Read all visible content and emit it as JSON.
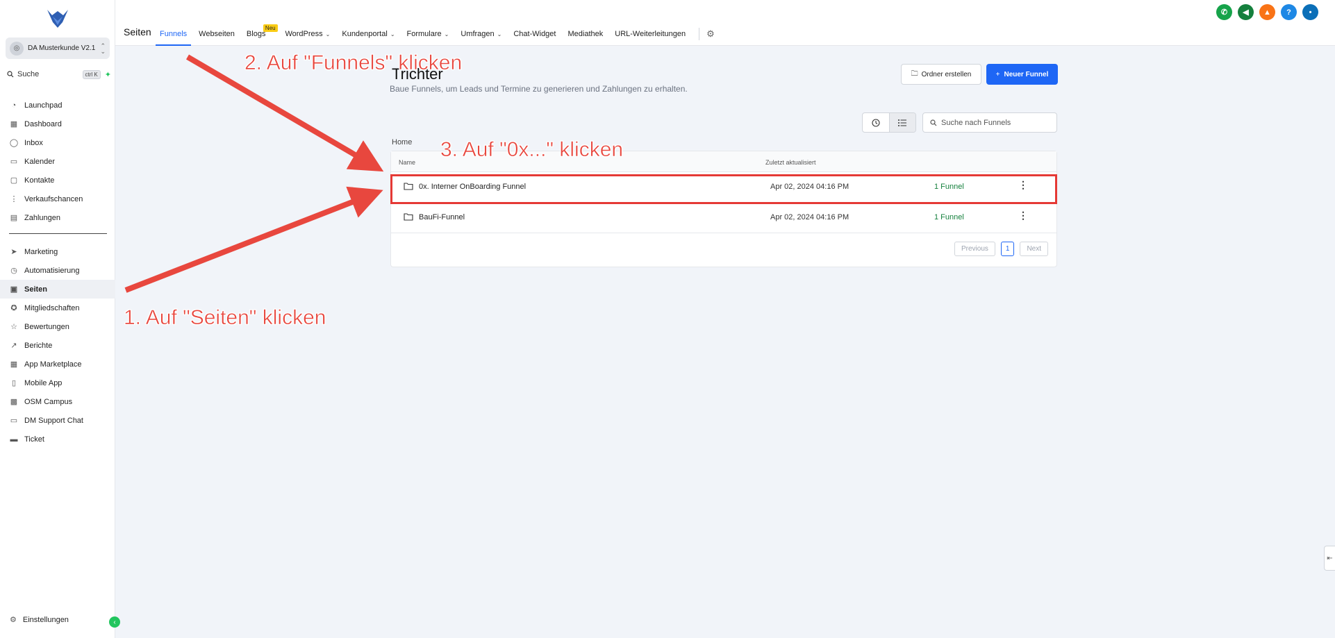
{
  "sidebar": {
    "account_name": "DA Musterkunde V2.1",
    "search_label": "Suche",
    "search_shortcut": "ctrl K",
    "items_top": [
      {
        "label": "Launchpad",
        "icon": "rocket-icon"
      },
      {
        "label": "Dashboard",
        "icon": "grid-icon"
      },
      {
        "label": "Inbox",
        "icon": "chat-icon"
      },
      {
        "label": "Kalender",
        "icon": "calendar-icon"
      },
      {
        "label": "Kontakte",
        "icon": "contacts-icon"
      },
      {
        "label": "Verkaufschancen",
        "icon": "pipeline-icon"
      },
      {
        "label": "Zahlungen",
        "icon": "payments-icon"
      }
    ],
    "items_bottom": [
      {
        "label": "Marketing",
        "icon": "send-icon"
      },
      {
        "label": "Automatisierung",
        "icon": "automation-icon"
      },
      {
        "label": "Seiten",
        "icon": "pages-icon",
        "active": true
      },
      {
        "label": "Mitgliedschaften",
        "icon": "award-icon"
      },
      {
        "label": "Bewertungen",
        "icon": "star-icon"
      },
      {
        "label": "Berichte",
        "icon": "chart-icon"
      },
      {
        "label": "App Marketplace",
        "icon": "apps-icon"
      },
      {
        "label": "Mobile App",
        "icon": "phone-icon"
      },
      {
        "label": "OSM Campus",
        "icon": "campus-icon"
      },
      {
        "label": "DM Support Chat",
        "icon": "support-icon"
      },
      {
        "label": "Ticket",
        "icon": "ticket-icon"
      }
    ],
    "settings_label": "Einstellungen"
  },
  "topbar": {
    "title": "Seiten",
    "tabs": [
      {
        "label": "Funnels",
        "active": true
      },
      {
        "label": "Webseiten"
      },
      {
        "label": "Blogs",
        "badge": "Neu"
      },
      {
        "label": "WordPress",
        "dropdown": true
      },
      {
        "label": "Kundenportal",
        "dropdown": true
      },
      {
        "label": "Formulare",
        "dropdown": true
      },
      {
        "label": "Umfragen",
        "dropdown": true
      },
      {
        "label": "Chat-Widget"
      },
      {
        "label": "Mediathek"
      },
      {
        "label": "URL-Weiterleitungen"
      }
    ],
    "right_icons": [
      {
        "name": "phone-icon",
        "color": "#16a34a"
      },
      {
        "name": "megaphone-icon",
        "color": "#15803d"
      },
      {
        "name": "bell-icon",
        "color": "#f97316"
      },
      {
        "name": "help-icon",
        "color": "#1e88e5"
      },
      {
        "name": "avatar",
        "color": "#0b6fb8"
      }
    ]
  },
  "main": {
    "heading": "Trichter",
    "subtitle": "Baue Funnels, um Leads und Termine zu generieren und Zahlungen zu erhalten.",
    "create_folder_label": "Ordner erstellen",
    "new_funnel_label": "Neuer Funnel",
    "search_placeholder": "Suche nach Funnels",
    "breadcrumb": "Home",
    "columns": {
      "name": "Name",
      "updated": "Zuletzt aktualisiert"
    },
    "rows": [
      {
        "name": "0x. Interner OnBoarding Funnel",
        "updated": "Apr 02, 2024 04:16 PM",
        "count": "1 Funnel"
      },
      {
        "name": "BauFi-Funnel",
        "updated": "Apr 02, 2024 04:16 PM",
        "count": "1 Funnel"
      }
    ],
    "pagination": {
      "previous": "Previous",
      "current": "1",
      "next": "Next"
    }
  },
  "annotations": {
    "step1": "1. Auf \"Seiten\" klicken",
    "step2": "2. Auf \"Funnels\" klicken",
    "step3": "3. Auf \"0x...\" klicken",
    "color": "#e8473e"
  }
}
